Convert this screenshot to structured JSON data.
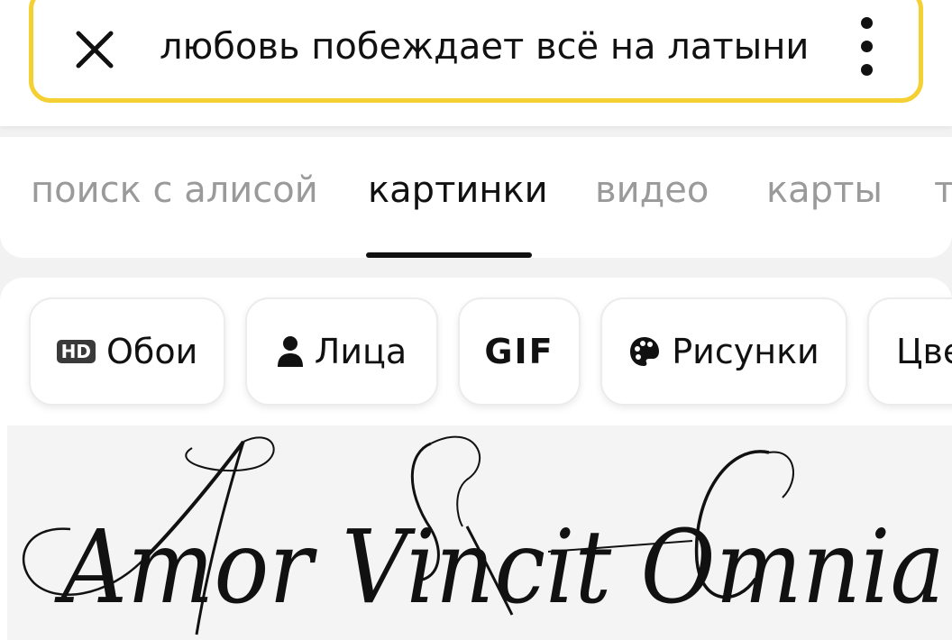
{
  "search": {
    "query": "любовь побеждает всё на латыни",
    "close_icon": "close-icon",
    "more_icon": "more-vertical-icon",
    "border_color": "#f5d033"
  },
  "tabs": [
    {
      "label": "поиск с алисой",
      "active": false
    },
    {
      "label": "картинки",
      "active": true
    },
    {
      "label": "видео",
      "active": false
    },
    {
      "label": "карты",
      "active": false
    },
    {
      "label": "т",
      "active": false
    }
  ],
  "filters": [
    {
      "label": "Обои",
      "icon": "hd-badge-icon",
      "badge": "HD"
    },
    {
      "label": "Лица",
      "icon": "person-icon"
    },
    {
      "label": "GIF"
    },
    {
      "label": "Рисунки",
      "icon": "palette-icon"
    },
    {
      "label": "Цве"
    }
  ],
  "result_image": {
    "text": "Amor Vincit Omnia"
  }
}
